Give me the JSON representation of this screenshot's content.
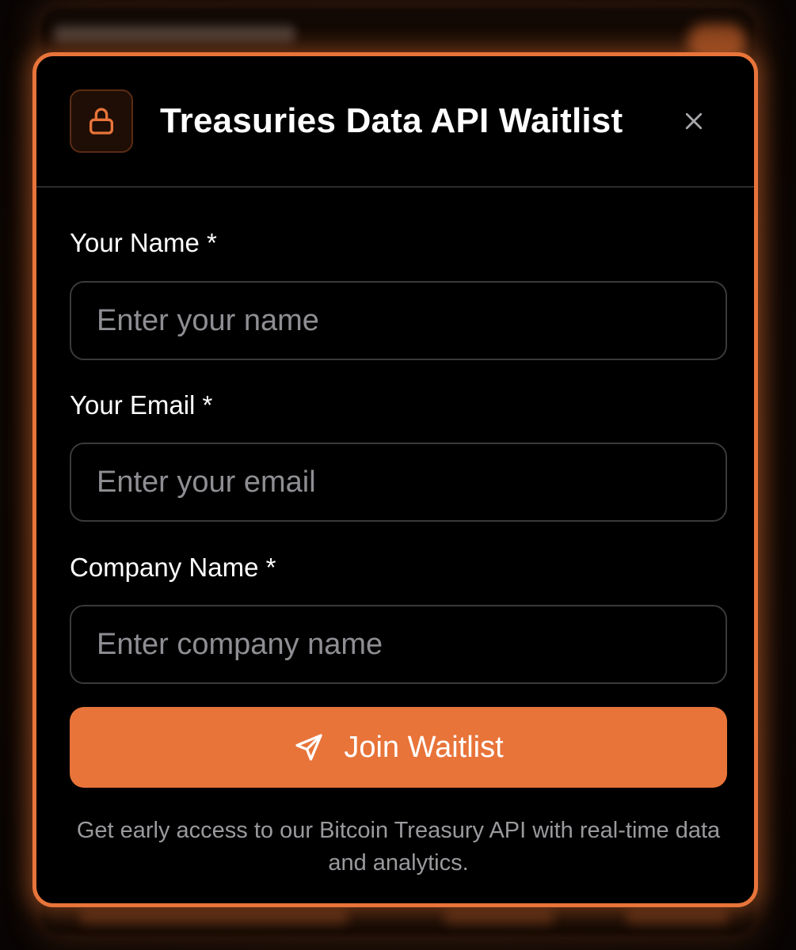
{
  "modal": {
    "title": "Treasuries Data API Waitlist",
    "icon": "lock-icon",
    "close_icon": "close-icon",
    "accent_color": "#e8743a"
  },
  "form": {
    "name_label": "Your Name *",
    "name_placeholder": "Enter your name",
    "email_label": "Your Email *",
    "email_placeholder": "Enter your email",
    "company_label": "Company Name *",
    "company_placeholder": "Enter company name",
    "submit_icon": "send-icon",
    "submit_label": "Join Waitlist"
  },
  "footer": {
    "note": "Get early access to our Bitcoin Treasury API with real-time data and analytics."
  }
}
